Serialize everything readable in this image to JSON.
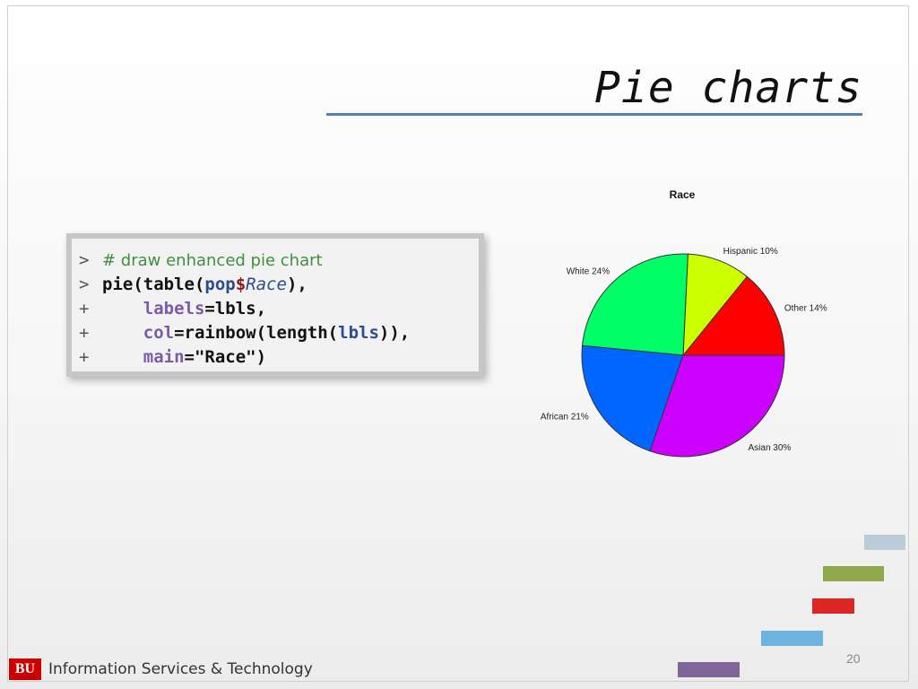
{
  "slide": {
    "title": "Pie charts",
    "page_number": "20",
    "footer_logo": "BU",
    "footer_text": "Information Services & Technology"
  },
  "code": {
    "prompt_primary": ">",
    "prompt_continue": "+",
    "line1_comment": "# draw enhanced pie chart",
    "line2_call": "pie(table(",
    "line2_obj": "pop",
    "line2_dollar": "$",
    "line2_field": "Race",
    "line2_end": "),",
    "line3_arg": "labels",
    "line3_rest": "=lbls,",
    "line4_arg": "col",
    "line4_rest1": "=rainbow(length(",
    "line4_obj": "lbls",
    "line4_rest2": ")),",
    "line5_arg": "main",
    "line5_rest": "=\"Race\")"
  },
  "colors": {
    "title_rule": "#4f81bd",
    "deco_bars": [
      "#b9ccd8",
      "#92a84c",
      "#dd2525",
      "#6cb3dd",
      "#80659a"
    ]
  },
  "chart_data": {
    "type": "pie",
    "title": "Race",
    "start_angle_deg": 0,
    "direction": "counterclockwise",
    "slices": [
      {
        "label": "Other 14%",
        "value": 14,
        "color": "#FF0000"
      },
      {
        "label": "Hispanic 10%",
        "value": 10,
        "color": "#CCFF00"
      },
      {
        "label": "White 24%",
        "value": 24,
        "color": "#00FF66"
      },
      {
        "label": "African 21%",
        "value": 21,
        "color": "#0066FF"
      },
      {
        "label": "Asian 30%",
        "value": 30,
        "color": "#CC00FF"
      }
    ]
  }
}
